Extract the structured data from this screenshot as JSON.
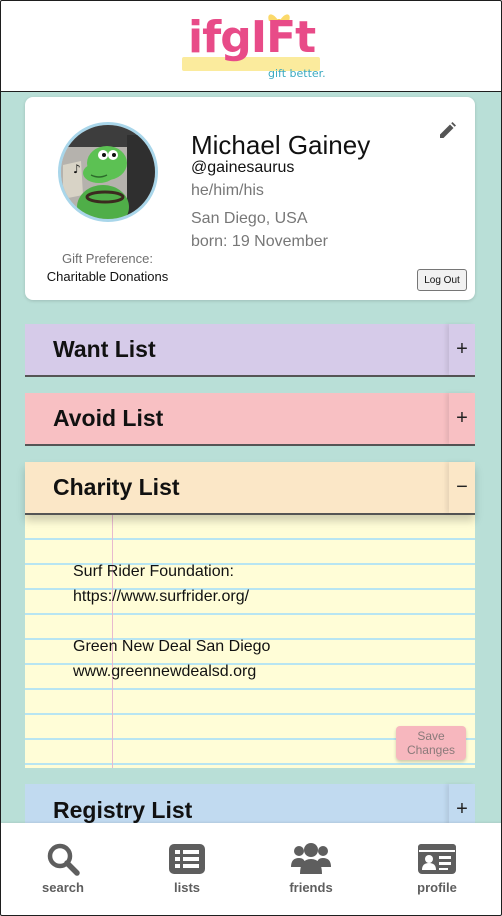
{
  "header": {
    "logo_text": "ifgIFt",
    "tagline": "gift better."
  },
  "profile": {
    "name": "Michael Gainey",
    "handle": "@gainesaurus",
    "pronouns": "he/him/his",
    "details": [
      "San Diego, USA",
      "born: 19 November"
    ],
    "gift_preference_label": "Gift Preference:",
    "gift_preference_value": "Charitable Donations",
    "logout_label": "Log Out",
    "edit_icon": "pencil-icon"
  },
  "lists": {
    "want": {
      "title": "Want List",
      "toggle": "+"
    },
    "avoid": {
      "title": "Avoid List",
      "toggle": "+"
    },
    "charity": {
      "title": "Charity List",
      "toggle": "−",
      "lines": [
        "Surf Rider Foundation:",
        "https://www.surfrider.org/",
        "",
        "Green New Deal San Diego",
        "www.greennewdealsd.org"
      ],
      "save_label": "Save Changes"
    },
    "registry": {
      "title": "Registry List",
      "toggle": "+"
    }
  },
  "nav": {
    "search": {
      "label": "search",
      "icon": "search-icon"
    },
    "lists": {
      "label": "lists",
      "icon": "list-icon"
    },
    "friends": {
      "label": "friends",
      "icon": "friends-icon"
    },
    "profile": {
      "label": "profile",
      "icon": "profile-card-icon"
    }
  },
  "colors": {
    "background": "#b9dfd7",
    "want": "#d6cbe9",
    "avoid": "#f8c0c3",
    "charity": "#fbe7c7",
    "registry": "#c1daf0",
    "logo_pink": "#e84b88",
    "tagline_blue": "#3aa9c0"
  }
}
